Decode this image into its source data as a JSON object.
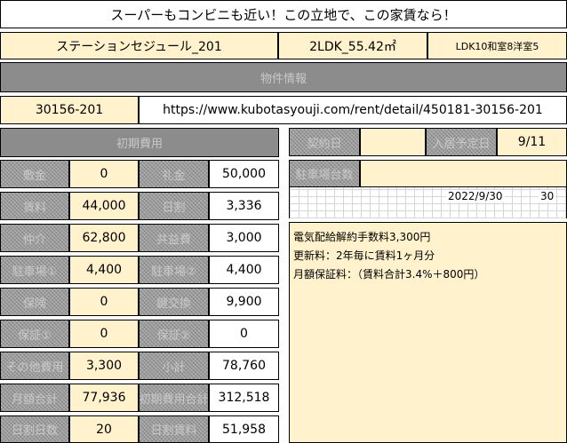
{
  "header": {
    "catch_copy": "スーパーもコンビニも近い！この立地で、この家賃なら！",
    "property_name": "ステーションセジュール_201",
    "floor_plan": "2LDK_55.42㎡",
    "room_detail": "LDK10和室8洋室5",
    "section_label": "物件情報"
  },
  "listing": {
    "id": "30156-201",
    "url": "https://www.kubotasyouji.com/rent/detail/450181-30156-201"
  },
  "costs": {
    "title": "初期費用",
    "rows": [
      {
        "label_a": "敷金",
        "value_a": "0",
        "label_b": "礼金",
        "value_b": "50,000"
      },
      {
        "label_a": "賃料",
        "value_a": "44,000",
        "label_b": "日割",
        "value_b": "3,336"
      },
      {
        "label_a": "仲介",
        "value_a": "62,800",
        "label_b": "共益費",
        "value_b": "3,000"
      },
      {
        "label_a": "駐車場①",
        "value_a": "4,400",
        "label_b": "駐車場②",
        "value_b": "4,400"
      },
      {
        "label_a": "保険",
        "value_a": "0",
        "label_b": "鍵交換",
        "value_b": "9,900"
      },
      {
        "label_a": "保証①",
        "value_a": "0",
        "label_b": "保証②",
        "value_b": "0"
      },
      {
        "label_a": "その他費用",
        "value_a": "3,300",
        "label_b": "小計",
        "value_b": "78,760"
      },
      {
        "label_a": "月額合計",
        "value_a": "77,936",
        "label_b": "初期費用合計",
        "value_b": "312,518"
      },
      {
        "label_a": "日割日数",
        "value_a": "20",
        "label_b": "日割賃料",
        "value_b": "51,958"
      }
    ]
  },
  "schedule": {
    "contract_label": "契約日",
    "contract_value": "",
    "movein_label": "入居予定日",
    "movein_value": "9/11",
    "parking_label": "駐車場台数",
    "parking_value": "",
    "date_value": "2022/9/30",
    "days_value": "30"
  },
  "notes": [
    "電気配給解約手数料3,300円",
    "更新料：2年毎に賃料1ヶ月分",
    "月額保証料：（賃料合計3.4%＋800円）"
  ]
}
